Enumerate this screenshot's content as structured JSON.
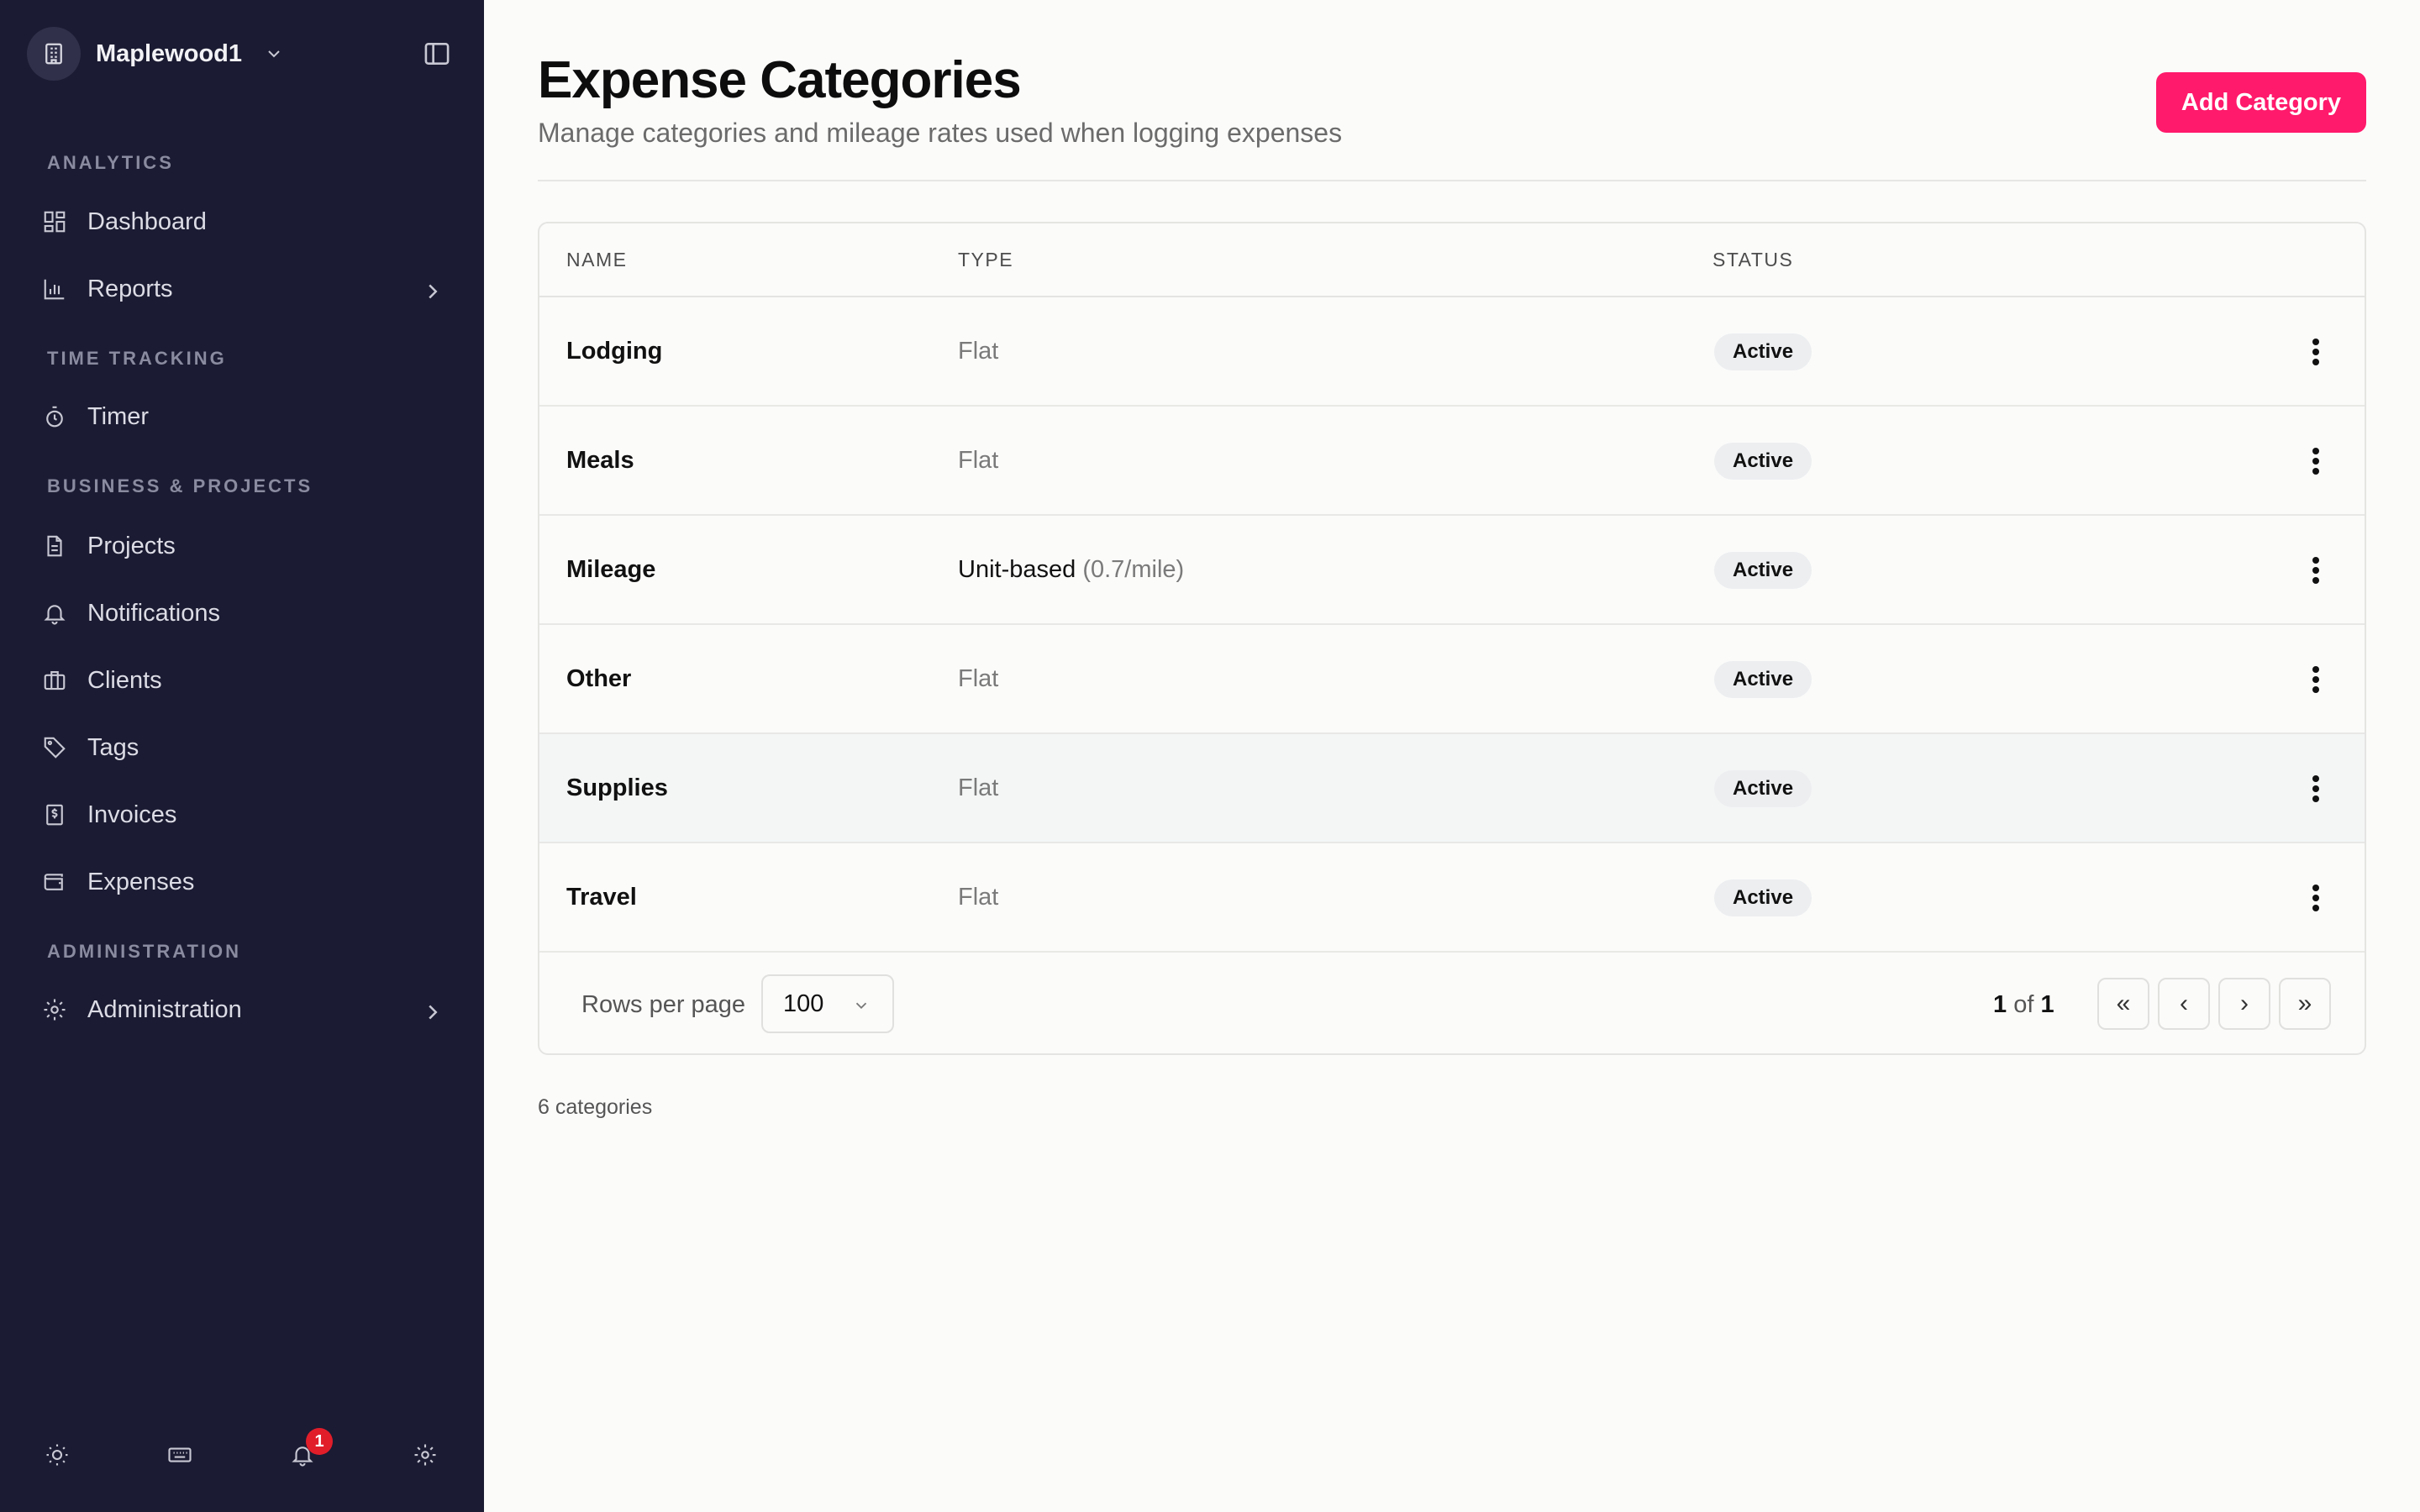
{
  "workspace": {
    "name": "Maplewood1"
  },
  "sidebar": {
    "sections": {
      "analytics": "ANALYTICS",
      "time_tracking": "TIME TRACKING",
      "business": "BUSINESS & PROJECTS",
      "administration": "ADMINISTRATION"
    },
    "items": {
      "dashboard": "Dashboard",
      "reports": "Reports",
      "timer": "Timer",
      "projects": "Projects",
      "notifications": "Notifications",
      "clients": "Clients",
      "tags": "Tags",
      "invoices": "Invoices",
      "expenses": "Expenses",
      "administration": "Administration"
    },
    "footer": {
      "notification_badge": "1"
    }
  },
  "page": {
    "title": "Expense Categories",
    "subtitle": "Manage categories and mileage rates used when logging expenses",
    "add_button": "Add Category"
  },
  "table": {
    "headers": {
      "name": "NAME",
      "type": "TYPE",
      "status": "STATUS"
    },
    "rows": [
      {
        "name": "Lodging",
        "type": "Flat",
        "type_detail": "",
        "status": "Active"
      },
      {
        "name": "Meals",
        "type": "Flat",
        "type_detail": "",
        "status": "Active"
      },
      {
        "name": "Mileage",
        "type": "Unit-based",
        "type_detail": "(0.7/mile)",
        "status": "Active"
      },
      {
        "name": "Other",
        "type": "Flat",
        "type_detail": "",
        "status": "Active"
      },
      {
        "name": "Supplies",
        "type": "Flat",
        "type_detail": "",
        "status": "Active"
      },
      {
        "name": "Travel",
        "type": "Flat",
        "type_detail": "",
        "status": "Active"
      }
    ],
    "footer": {
      "rows_per_page_label": "Rows per page",
      "rows_per_page_value": "100",
      "page_current": "1",
      "page_of": "of",
      "page_total": "1",
      "first": "«",
      "prev": "‹",
      "next": "›",
      "last": "»"
    }
  },
  "summary": {
    "count_text": "6 categories"
  },
  "colors": {
    "sidebar_bg": "#1b1b33",
    "accent": "#ff1a6b",
    "badge": "#e11d2a"
  }
}
